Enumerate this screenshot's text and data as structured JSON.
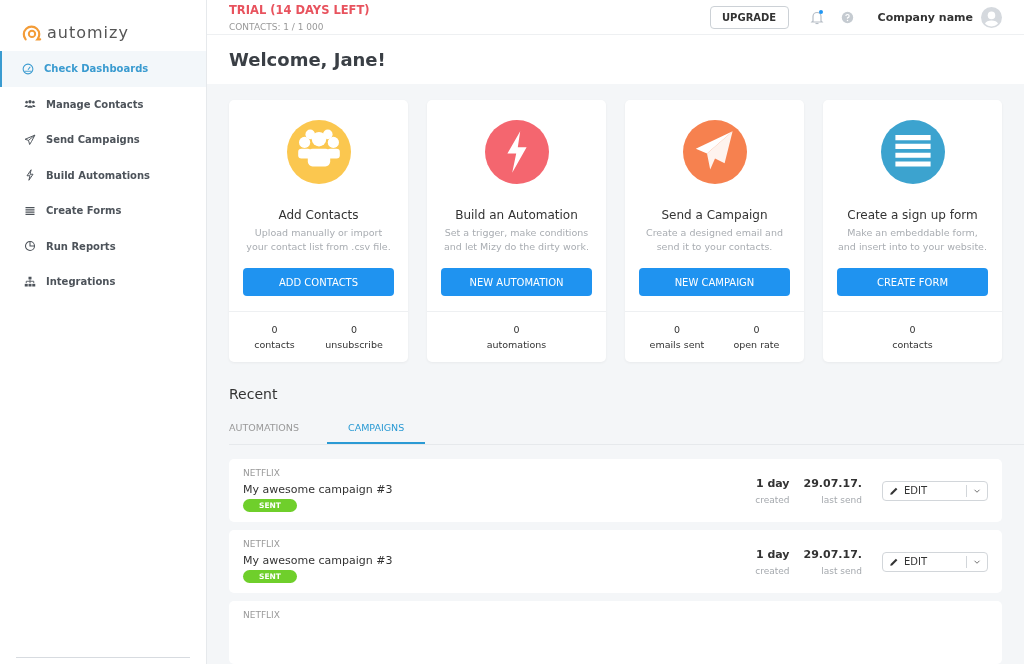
{
  "brand": {
    "name": "automizy"
  },
  "sidebar": {
    "items": [
      {
        "label": "Check Dashboards",
        "kind": "gauge",
        "selected": true
      },
      {
        "label": "Manage Contacts",
        "kind": "people",
        "selected": false
      },
      {
        "label": "Send Campaigns",
        "kind": "plane",
        "selected": false
      },
      {
        "label": "Build Automations",
        "kind": "bolt",
        "selected": false
      },
      {
        "label": "Create Forms",
        "kind": "list",
        "selected": false
      },
      {
        "label": "Run Reports",
        "kind": "chart",
        "selected": false
      },
      {
        "label": "Integrations",
        "kind": "network",
        "selected": false
      }
    ]
  },
  "header": {
    "trial": "TRIAL (14 DAYS LEFT)",
    "contacts": "CONTACTS: 1 / 1 000",
    "upgrade": "UPGRADE",
    "notification": true,
    "account": "Company name"
  },
  "welcome": "Welcome, Jane!",
  "cards": [
    {
      "kind": "people",
      "color": "#fbc74f",
      "title": "Add Contacts",
      "description": "Upload manually or import your contact list from .csv file.",
      "button": "ADD CONTACTS",
      "stats": [
        {
          "value": "0",
          "label": "contacts"
        },
        {
          "value": "0",
          "label": "unsubscribe"
        }
      ]
    },
    {
      "kind": "bolt",
      "color": "#f4666f",
      "title": "Build an Automation",
      "description": "Set a trigger, make conditions and let Mizy do the dirty work.",
      "button": "NEW AUTOMATION",
      "stats": [
        {
          "value": "0",
          "label": "automations"
        }
      ]
    },
    {
      "kind": "plane",
      "color": "#f6814f",
      "title": "Send a Campaign",
      "description": "Create a designed email and send it to your contacts.",
      "button": "NEW CAMPAIGN",
      "stats": [
        {
          "value": "0",
          "label": "emails sent"
        },
        {
          "value": "0",
          "label": "open rate"
        }
      ]
    },
    {
      "kind": "list",
      "color": "#3ca3cf",
      "title": "Create a sign up form",
      "description": "Make an embeddable form, and insert into to your website.",
      "button": "CREATE FORM",
      "stats": [
        {
          "value": "0",
          "label": "contacts"
        }
      ]
    }
  ],
  "recent": {
    "title": "Recent",
    "tabs": [
      {
        "label": "AUTOMATIONS",
        "selected": false
      },
      {
        "label": "CAMPAIGNS",
        "selected": true
      }
    ],
    "rows": [
      {
        "company": "NETFLIX",
        "name": "My awesome campaign #3",
        "status": "SENT",
        "created": "1 day",
        "created_label": "created",
        "last_send": "29.07.17.",
        "last_send_label": "last send",
        "action": "EDIT"
      },
      {
        "company": "NETFLIX",
        "name": "My awesome campaign #3",
        "status": "SENT",
        "created": "1 day",
        "created_label": "created",
        "last_send": "29.07.17.",
        "last_send_label": "last send",
        "action": "EDIT"
      },
      {
        "company": "NETFLIX"
      }
    ]
  }
}
